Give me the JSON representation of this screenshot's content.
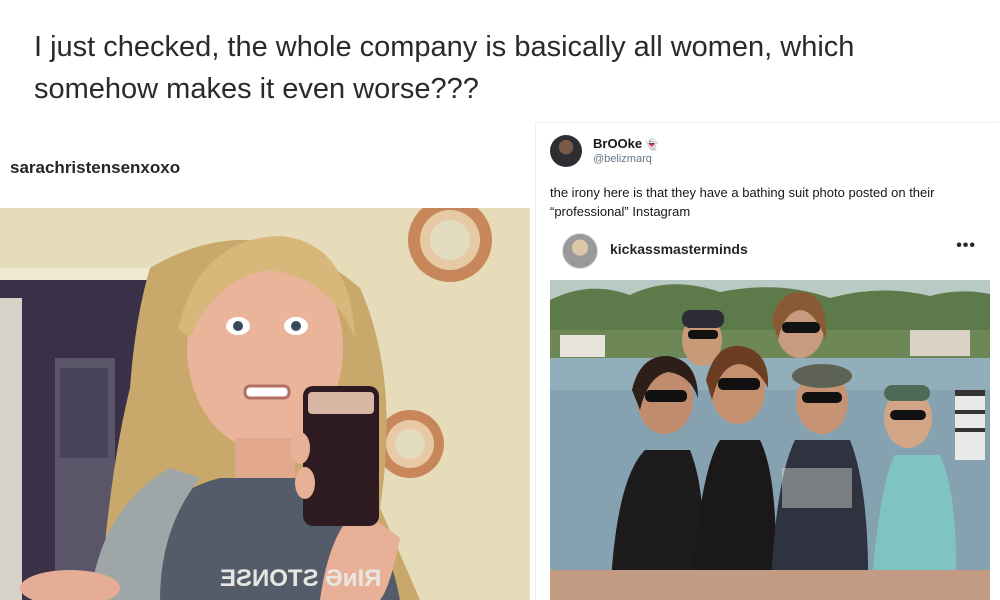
{
  "caption": {
    "line1": "I just checked, the whole company is basically all women, which",
    "line2": "somehow makes it even worse???"
  },
  "left_post": {
    "username": "sarachristensenxoxo",
    "shirt_text": "ƎƧИOTƧ ƏᴎIЯ"
  },
  "tweet": {
    "name": "BrOOke",
    "name_emoji": "👻",
    "handle": "@belizmarq",
    "text": "the irony here is that they have a bathing suit photo posted on their “professional” Instagram",
    "embed": {
      "username": "kickassmasterminds",
      "more_label": "•••"
    }
  },
  "colors": {
    "text": "#2a2a2a",
    "handle": "#657786",
    "wall": "#e5dbb8",
    "lake": "#8fa9b6"
  }
}
